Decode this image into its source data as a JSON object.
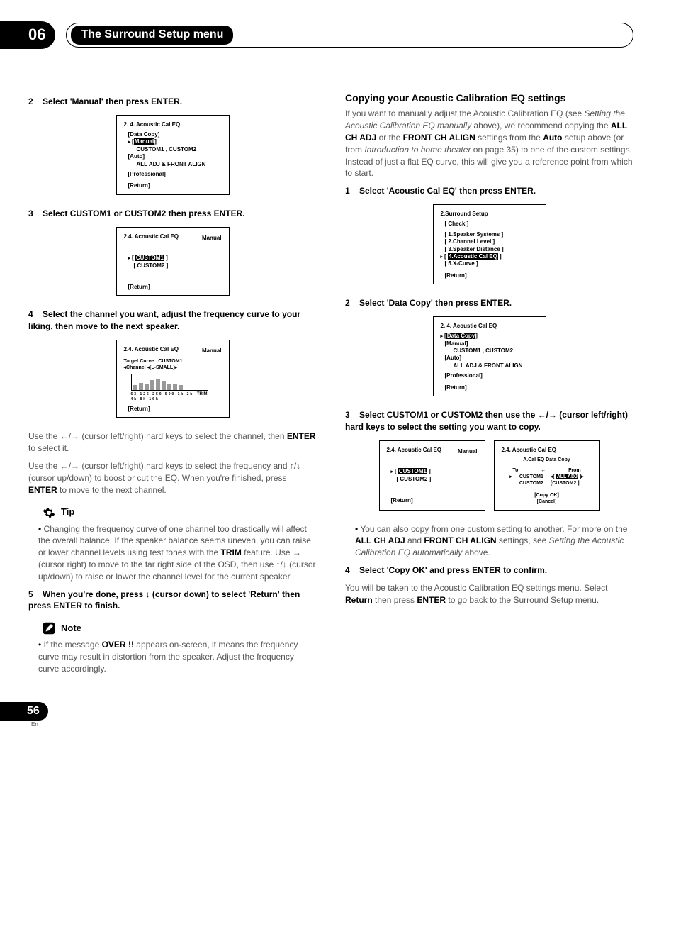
{
  "header": {
    "chapter_num": "06",
    "chapter_title": "The Surround Setup menu"
  },
  "left": {
    "step2": "Select 'Manual' then press ENTER.",
    "osd1": {
      "title": "2. 4. Acoustic  Cal  EQ",
      "data_copy": "[Data Copy]",
      "manual": "Manual",
      "manual_sub": "CUSTOM1 , CUSTOM2",
      "auto": "[Auto]",
      "auto_sub": "ALL ADJ & FRONT ALIGN",
      "pro": "[Professional]",
      "ret": "[Return]"
    },
    "step3": "Select CUSTOM1 or CUSTOM2 then press ENTER.",
    "osd2": {
      "title": "2.4. Acoustic  Cal  EQ",
      "sub": "Manual",
      "c1": "CUSTOM1",
      "c2": "[ CUSTOM2 ]",
      "ret": "[Return]"
    },
    "step4": "Select the channel you want, adjust the frequency curve to your liking, then move to the next speaker.",
    "osd3": {
      "title": "2.4. Acoustic  Cal  EQ",
      "sub": "Manual",
      "target": "Target Curve : CUSTOM1",
      "channel": "[L-SMALL]",
      "channel_pre": "Channel",
      "trim": "TRIM",
      "axis": "63 125 250 500 1k 2k 4k 8k 16k",
      "ret": "[Return]"
    },
    "use1_a": "Use the ",
    "use1_b": " (cursor left/right) hard keys to select the channel, then ",
    "use1_c": " to select it.",
    "enter": "ENTER",
    "use2_a": "Use the ",
    "use2_b": " (cursor left/right) hard keys to select the frequency and ",
    "use2_c": " (cursor up/down) to boost or cut the EQ. When you're finished, press ",
    "use2_d": " to move to the next channel.",
    "tip_label": "Tip",
    "tip_a": "Changing the frequency curve of one channel too drastically will affect the overall balance. If the speaker balance seems uneven, you can raise or lower channel levels using test tones with the ",
    "tip_b": " feature. Use ",
    "tip_c": " (cursor right) to move to the far right side of the OSD, then use ",
    "tip_d": " (cursor up/down) to raise or lower the channel level for the current speaker.",
    "trim": "TRIM",
    "step5_a": "When you're done, press ",
    "step5_b": " (cursor down) to select 'Return' then press ENTER to finish.",
    "note_label": "Note",
    "note_a": "If the message ",
    "note_b": " appears on-screen, it means the frequency curve may result in distortion from the speaker. Adjust the frequency curve accordingly.",
    "over": "OVER !!"
  },
  "right": {
    "section_title": "Copying your Acoustic Calibration EQ settings",
    "intro_a": "If you want to manually adjust the Acoustic Calibration EQ (see ",
    "intro_i": "Setting the Acoustic Calibration EQ manually",
    "intro_b": " above), we recommend copying the ",
    "all_ch": "ALL CH ADJ",
    "intro_c": " or the ",
    "front_ch": "FRONT CH ALIGN",
    "intro_d": " settings from the ",
    "auto": "Auto",
    "intro_e": " setup above (or from ",
    "intro_i2": "Introduction to home theater",
    "intro_f": " on page 35) to one of the custom settings. Instead of just a flat EQ curve, this will give you a reference point from which to start.",
    "step1": "Select 'Acoustic Cal EQ' then press ENTER.",
    "osd4": {
      "title": "2.Surround Setup",
      "check": "[ Check ]",
      "l1": "[ 1.Speaker Systems ]",
      "l2": "[ 2.Channel Level ]",
      "l3": "[ 3.Speaker Distance ]",
      "l4": "4.Acoustic Cal EQ",
      "l5": "[ 5.X-Curve ]",
      "ret": "[Return]"
    },
    "step2": "Select 'Data Copy' then press ENTER.",
    "osd5": {
      "title": "2. 4. Acoustic  Cal  EQ",
      "dc": "Data Copy",
      "manual": "[Manual]",
      "manual_sub": "CUSTOM1 , CUSTOM2",
      "auto": "[Auto]",
      "auto_sub": "ALL ADJ & FRONT ALIGN",
      "pro": "[Professional]",
      "ret": "[Return]"
    },
    "step3_a": "Select CUSTOM1 or CUSTOM2 then use the ",
    "step3_b": " (cursor left/right) hard keys to select the setting you want to copy.",
    "osd6a": {
      "title": "2.4. Acoustic  Cal  EQ",
      "sub": "Manual",
      "c1": "CUSTOM1",
      "c2": "[ CUSTOM2 ]",
      "ret": "[Return]"
    },
    "osd6b": {
      "title": "2.4. Acoustic  Cal  EQ",
      "sub": "A.Cal EQ Data Copy",
      "to": "To",
      "from": "From",
      "to1": "CUSTOM1",
      "to2": "CUSTOM2",
      "from1": "ALL ADJ",
      "from2": "[CUSTOM2 ]",
      "copyok": "[Copy OK]",
      "cancel": "[Cancel]"
    },
    "bullet_a": "You can also copy from one custom setting to another. For more on the ",
    "bullet_b": " and ",
    "bullet_c": " settings, see ",
    "bullet_i": "Setting the Acoustic Calibration EQ automatically",
    "bullet_d": " above.",
    "step4": "Select 'Copy OK' and press ENTER to confirm.",
    "outro_a": "You will be taken to the Acoustic Calibration EQ settings menu. Select ",
    "return": "Return",
    "outro_b": " then press ",
    "enter": "ENTER",
    "outro_c": " to go back to the Surround Setup menu."
  },
  "footer": {
    "page": "56",
    "lang": "En"
  }
}
